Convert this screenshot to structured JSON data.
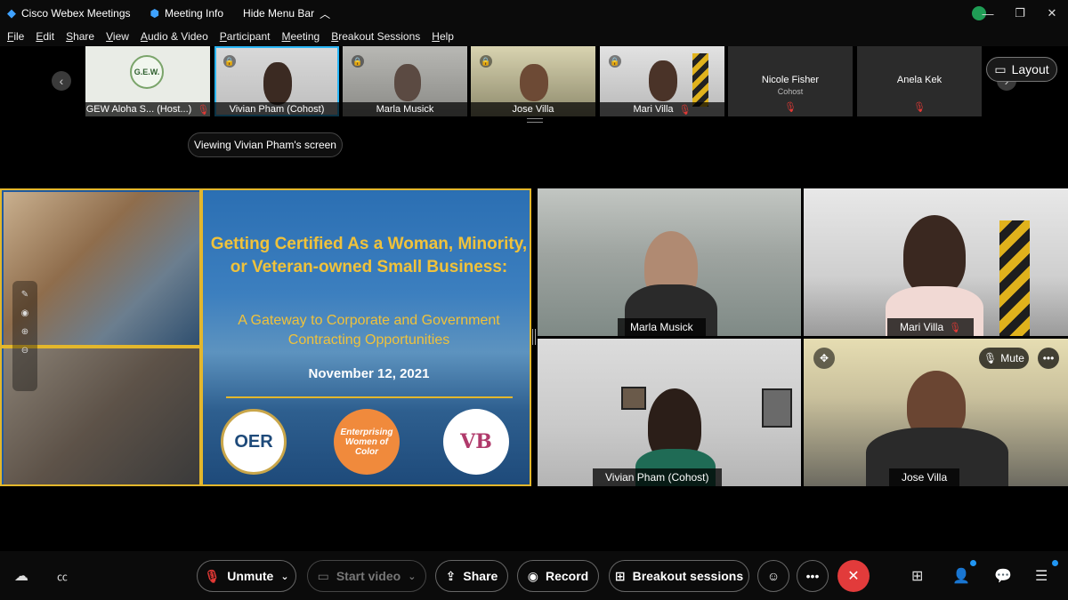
{
  "titlebar": {
    "app_name": "Cisco Webex Meetings",
    "meeting_info": "Meeting Info",
    "hide_menu": "Hide Menu Bar",
    "minimize": "—",
    "restore": "❐",
    "close": "✕"
  },
  "menubar": [
    "File",
    "Edit",
    "Share",
    "View",
    "Audio & Video",
    "Participant",
    "Meeting",
    "Breakout Sessions",
    "Help"
  ],
  "filmstrip": {
    "prev": "‹",
    "next": "›",
    "items": [
      {
        "label": "GEW Aloha S... (Host...)",
        "logo_text": "G.E.W."
      },
      {
        "label": "Vivian Pham  (Cohost)"
      },
      {
        "label": "Marla Musick"
      },
      {
        "label": "Jose Villa"
      },
      {
        "label": "Mari Villa"
      },
      {
        "name": "Nicole Fisher",
        "role": "Cohost"
      },
      {
        "name": "Anela Kek"
      }
    ]
  },
  "layout_button": "Layout",
  "viewing_banner": "Viewing Vivian Pham's screen",
  "slide": {
    "title": "Getting Certified As a Woman, Minority, or Veteran-owned Small Business:",
    "subtitle": "A Gateway to Corporate and Government Contracting Opportunities",
    "date": "November 12, 2021",
    "logos": [
      "OER",
      "Enterprising Women of Color",
      "VB"
    ]
  },
  "tiles": [
    {
      "name": "Marla Musick"
    },
    {
      "name": "Mari Villa"
    },
    {
      "name": "Vivian Pham  (Cohost)"
    },
    {
      "name": "Jose Villa"
    }
  ],
  "tile_controls": {
    "mute": "Mute",
    "more": "•••"
  },
  "controls": {
    "unmute": "Unmute",
    "start_video": "Start video",
    "share": "Share",
    "record": "Record",
    "breakout": "Breakout sessions",
    "more": "•••"
  },
  "colors": {
    "accent": "#29b6f6",
    "end_call": "#e23b3b",
    "slide_gold": "#e3b72c",
    "slide_blue": "#1f5aa0"
  }
}
